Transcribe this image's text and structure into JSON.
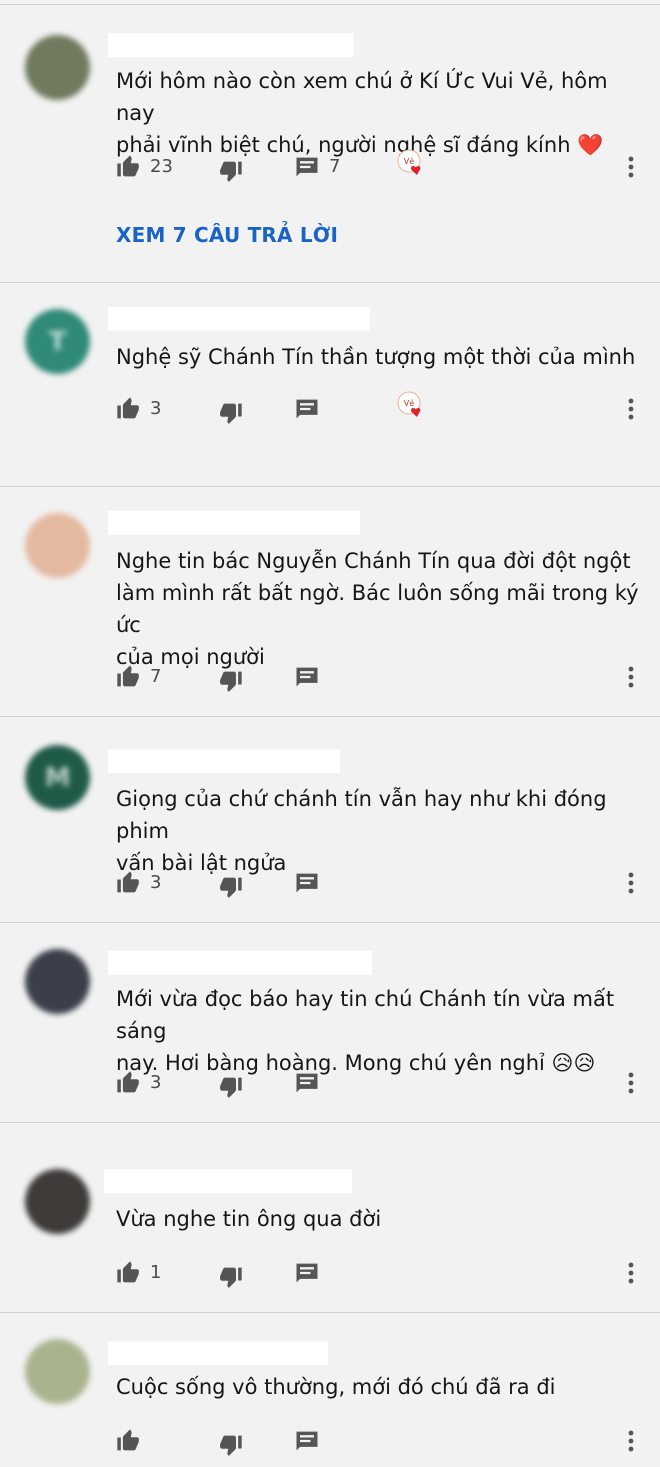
{
  "colors": {
    "background": "#f2f2f2",
    "divider": "#d2d2d2",
    "icon": "#555555",
    "link": "#1a64c8",
    "heart": "#e0202a"
  },
  "comments": [
    {
      "avatar_color": "#6f7a5e",
      "avatar_letter": "",
      "text": "Mới hôm nào còn xem chú ở Kí Ức Vui Vẻ, hôm nay\nphải vĩnh biệt chú, người nghệ sĩ đáng kính ❤️",
      "likes": "23",
      "replies": "7",
      "creator_heart": true,
      "view_replies_label": "XEM 7 CÂU TRẢ LỜI"
    },
    {
      "avatar_color": "#2f8a78",
      "avatar_letter": "T",
      "text": "Nghệ sỹ Chánh Tín thần tượng một thời của mình",
      "likes": "3",
      "replies": "",
      "creator_heart": true
    },
    {
      "avatar_color": "#e4b9a0",
      "avatar_letter": "",
      "text": "Nghe tin bác Nguyễn Chánh Tín qua đời đột ngột\nlàm mình rất bất ngờ. Bác luôn sống mãi trong ký ức\ncủa mọi người",
      "likes": "7",
      "replies": "",
      "creator_heart": false
    },
    {
      "avatar_color": "#1f5a48",
      "avatar_letter": "M",
      "text": "Giọng của chứ chánh tín vẫn hay như khi đóng phim\nvấn bài lật ngửa",
      "likes": "3",
      "replies": "",
      "creator_heart": false
    },
    {
      "avatar_color": "#3a3f4a",
      "avatar_letter": "",
      "text": "Mới vừa đọc báo hay tin chú Chánh tín vừa mất sáng\nnay. Hơi bàng hoàng. Mong chú yên nghỉ 😥😥",
      "likes": "3",
      "replies": "",
      "creator_heart": false
    },
    {
      "avatar_color": "#3e3b38",
      "avatar_letter": "",
      "text": "Vừa nghe tin ông qua đời",
      "likes": "1",
      "replies": "",
      "creator_heart": false
    },
    {
      "avatar_color": "#a9b48f",
      "avatar_letter": "",
      "text": "Cuộc sống vô thường, mới đó chú đã ra đi",
      "likes": "",
      "replies": "",
      "creator_heart": false
    }
  ]
}
